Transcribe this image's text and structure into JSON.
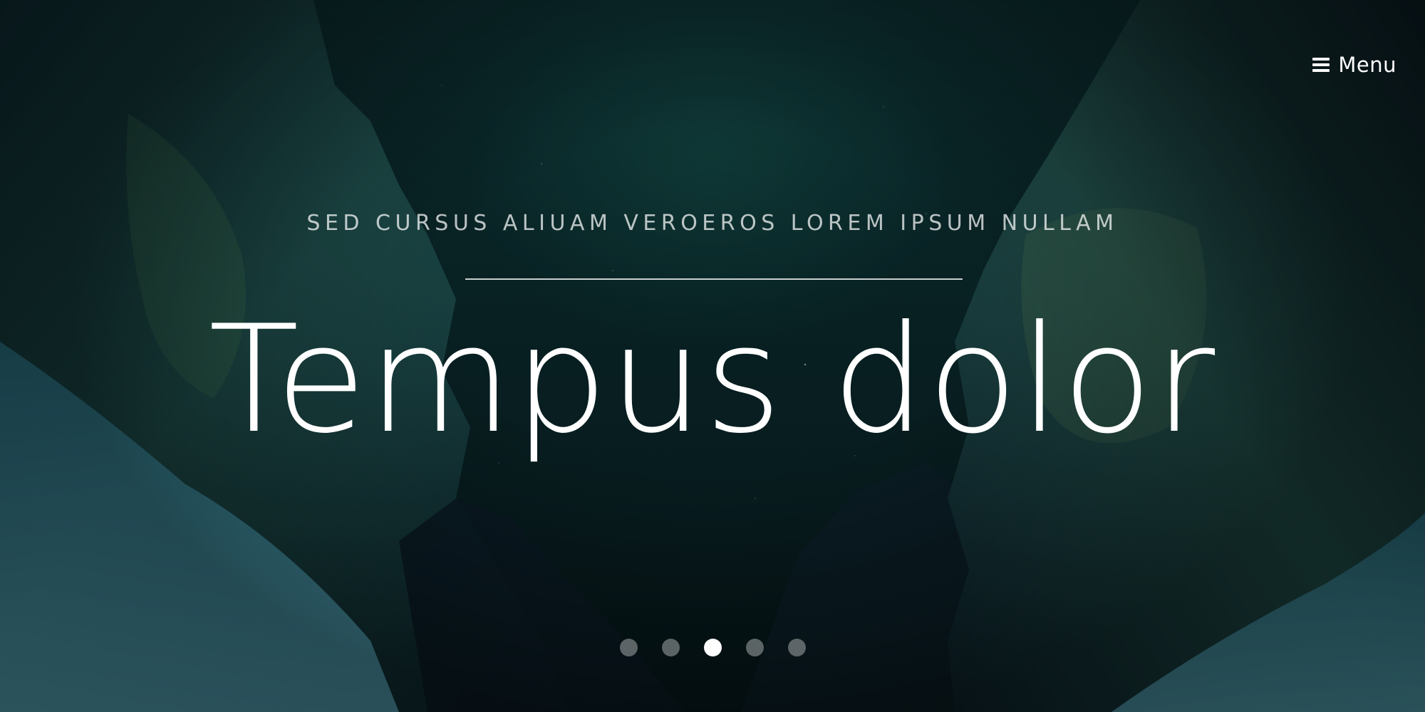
{
  "header": {
    "menu_label": "Menu"
  },
  "hero": {
    "tagline": "SED CURSUS ALIUAM VEROEROS LOREM IPSUM NULLAM",
    "headline": "Tempus dolor"
  },
  "pager": {
    "active_index": 2,
    "slide_count": 5
  },
  "colors": {
    "text": "#ffffff",
    "background": "#082022",
    "dot_inactive": "rgba(255,255,255,0.35)",
    "dot_active": "#ffffff"
  }
}
